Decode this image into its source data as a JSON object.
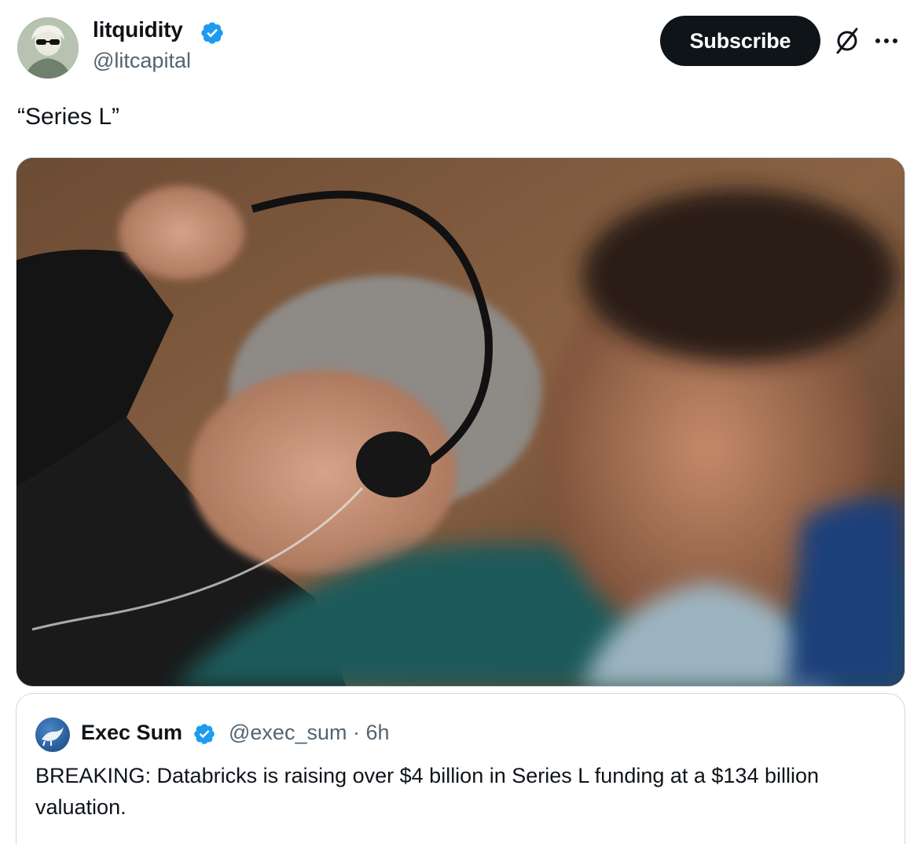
{
  "author": {
    "name": "litquidity",
    "handle": "@litcapital",
    "verified": true
  },
  "actions": {
    "subscribe_label": "Subscribe"
  },
  "icons": {
    "verified": "verified-badge-icon",
    "grok": "grok-icon",
    "more": "more-options-icon"
  },
  "tweet": {
    "text": "“Series L”"
  },
  "quoted_tweet": {
    "name": "Exec Sum",
    "handle": "@exec_sum · 6h",
    "text": "BREAKING: Databricks is raising over $4 billion in Series L funding at a $134 billion valuation."
  },
  "colors": {
    "text_primary": "#0f1419",
    "text_secondary": "#536471",
    "verified_blue": "#1d9bf0",
    "border": "#cfd9de",
    "button_bg": "#0f1419"
  }
}
